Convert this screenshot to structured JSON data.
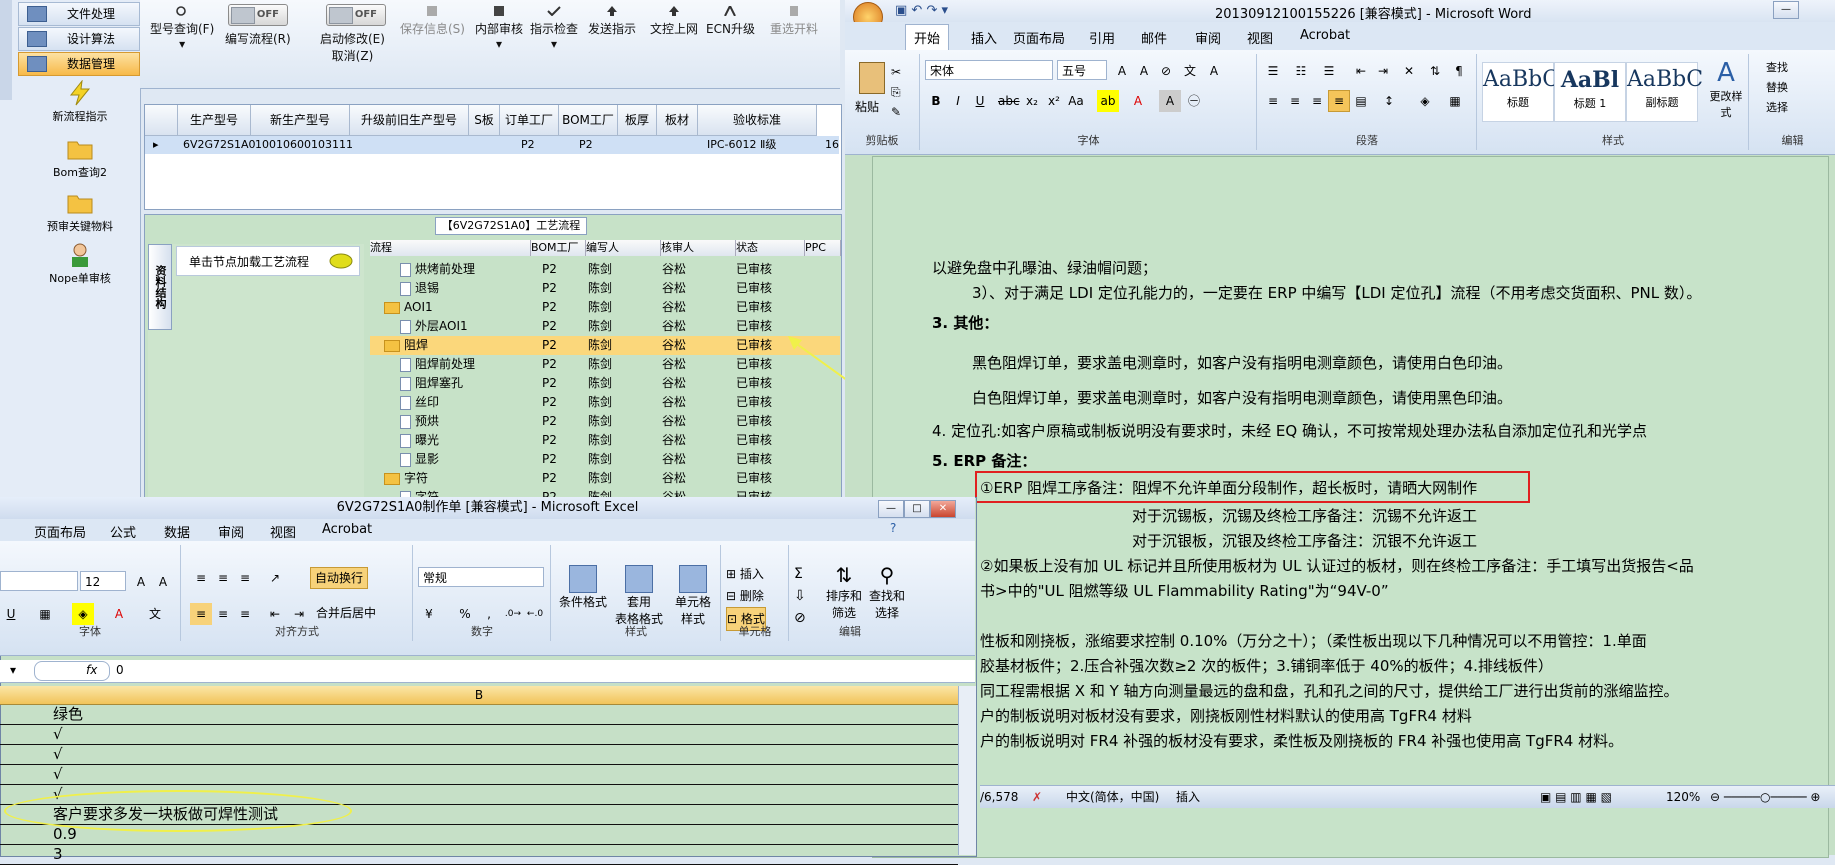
{
  "left_app": {
    "nav": [
      "文件处理",
      "设计算法",
      "数据管理"
    ],
    "tools": [
      "新流程指示",
      "Bom查询2",
      "预审关键物料",
      "Nope单审核"
    ],
    "toolbar": {
      "model_query": "型号查询(F)",
      "edit_flow": "编写流程(R)",
      "start_modify": "启动修改(E)",
      "cancel": "取消(Z)",
      "save_info": "保存信息(S)",
      "internal_review": "内部审核",
      "instruction_check": "指示检查",
      "send_instruction": "发送指示",
      "text_upload": "文控上网",
      "ecn_upgrade": "ECN升级",
      "rename": "重选开料",
      "toggle_off": "OFF"
    },
    "grid": {
      "headers": [
        "生产型号",
        "新生产型号",
        "升级前旧生产型号",
        "S板",
        "订单工厂",
        "BOM工厂",
        "板厚",
        "板材",
        "验收标准"
      ],
      "row": [
        "6V2G72S1A0",
        "10010600103111",
        "",
        "",
        "P2",
        "P2",
        "",
        "",
        "IPC-6012 Ⅱ级",
        "16"
      ]
    },
    "process_title": "【6V2G72S1A0】工艺流程",
    "vertical_tab": "资料结构",
    "side_hint": "单击节点加载工艺流程",
    "tree_headers": [
      "流程",
      "BOM工厂",
      "编写人",
      "核审人",
      "状态",
      "PPC"
    ],
    "tree_rows": [
      {
        "name": "烘烤前处理",
        "kind": "doc",
        "indent": 1,
        "f": "P2",
        "w": "陈剑",
        "c": "谷松",
        "s": "已审核"
      },
      {
        "name": "退锡",
        "kind": "doc",
        "indent": 1,
        "f": "P2",
        "w": "陈剑",
        "c": "谷松",
        "s": "已审核"
      },
      {
        "name": "AOI1",
        "kind": "folder",
        "indent": 0,
        "f": "P2",
        "w": "陈剑",
        "c": "谷松",
        "s": "已审核"
      },
      {
        "name": "外层AOI1",
        "kind": "doc",
        "indent": 1,
        "f": "P2",
        "w": "陈剑",
        "c": "谷松",
        "s": "已审核"
      },
      {
        "name": "阻焊",
        "kind": "folder",
        "indent": 0,
        "f": "P2",
        "w": "陈剑",
        "c": "谷松",
        "s": "已审核",
        "selected": true
      },
      {
        "name": "阻焊前处理",
        "kind": "doc",
        "indent": 1,
        "f": "P2",
        "w": "陈剑",
        "c": "谷松",
        "s": "已审核"
      },
      {
        "name": "阻焊塞孔",
        "kind": "doc",
        "indent": 1,
        "f": "P2",
        "w": "陈剑",
        "c": "谷松",
        "s": "已审核"
      },
      {
        "name": "丝印",
        "kind": "doc",
        "indent": 1,
        "f": "P2",
        "w": "陈剑",
        "c": "谷松",
        "s": "已审核"
      },
      {
        "name": "预烘",
        "kind": "doc",
        "indent": 1,
        "f": "P2",
        "w": "陈剑",
        "c": "谷松",
        "s": "已审核"
      },
      {
        "name": "曝光",
        "kind": "doc",
        "indent": 1,
        "f": "P2",
        "w": "陈剑",
        "c": "谷松",
        "s": "已审核"
      },
      {
        "name": "显影",
        "kind": "doc",
        "indent": 1,
        "f": "P2",
        "w": "陈剑",
        "c": "谷松",
        "s": "已审核"
      },
      {
        "name": "字符",
        "kind": "folder",
        "indent": 0,
        "f": "P2",
        "w": "陈剑",
        "c": "谷松",
        "s": "已审核"
      },
      {
        "name": "字符",
        "kind": "doc",
        "indent": 1,
        "f": "P2",
        "w": "陈剑",
        "c": "谷松",
        "s": "已审核"
      }
    ]
  },
  "word": {
    "title": "20130912100155226 [兼容模式] - Microsoft Word",
    "tabs": [
      "开始",
      "插入",
      "页面布局",
      "引用",
      "邮件",
      "审阅",
      "视图",
      "Acrobat"
    ],
    "font_name": "宋体",
    "font_size": "五号",
    "groups": {
      "clipboard": "剪贴板",
      "font": "字体",
      "paragraph": "段落",
      "styles": "样式",
      "editing": "编辑"
    },
    "paste": "粘贴",
    "change_styles": "更改样式",
    "styles": [
      {
        "preview": "AaBbC",
        "name": "标题"
      },
      {
        "preview": "AaBl",
        "name": "标题 1"
      },
      {
        "preview": "AaBbC",
        "name": "副标题"
      }
    ],
    "right_items": [
      "查找",
      "替换",
      "选择"
    ],
    "lines": [
      "以避免盘中孔曝油、绿油帽问题；",
      "3）、对于满足 LDI 定位孔能力的，一定要在 ERP 中编写【LDI 定位孔】流程（不用考虑交货面积、PNL 数）。",
      "3. 其他：",
      "黑色阻焊订单，要求盖电测章时，如客户没有指明电测章颜色，请使用白色印油。",
      "白色阻焊订单，要求盖电测章时，如客户没有指明电测章颜色，请使用黑色印油。",
      "4. 定位孔:如客户原稿或制板说明没有要求时，未经 EQ 确认，不可按常规处理办法私自添加定位孔和光学点",
      "5. ERP 备注：",
      "①ERP 阻焊工序备注：阻焊不允许单面分段制作，超长板时，请晒大网制作",
      "对于沉锡板，沉锡及终检工序备注：沉锡不允许返工",
      "对于沉银板，沉银及终检工序备注：沉银不允许返工",
      "②如果板上没有加 UL 标记并且所使用板材为 UL 认证过的板材，则在终检工序备注：手工填写出货报告<品",
      "书>中的\"UL 阻燃等级 UL Flammability Rating\"为“94V-0”",
      "性板和刚挠板，涨缩要求控制 0.10%（万分之十）；（柔性板出现以下几种情况可以不用管控：1.单面",
      "胶基材板件；2.压合补强次数≥2 次的板件；3.铺铜率低于 40%的板件；4.排线板件）",
      "同工程需根据 X 和 Y 轴方向测量最远的盘和盘，孔和孔之间的尺寸，提供给工厂进行出货前的涨缩监控。",
      "户的制板说明对板材没有要求，刚挠板刚性材料默认的使用高 TgFR4 材料",
      "户的制板说明对 FR4 补强的板材没有要求，柔性板及刚挠板的 FR4 补强也使用高 TgFR4 材料。"
    ],
    "status": {
      "words": "/6,578",
      "lang": "中文(简体，中国)",
      "mode": "插入",
      "zoom": "120%"
    }
  },
  "excel": {
    "title": "6V2G72S1A0制作单 [兼容模式] - Microsoft Excel",
    "tabs": [
      "页面布局",
      "公式",
      "数据",
      "审阅",
      "视图",
      "Acrobat"
    ],
    "font_size": "12",
    "wrap": "自动换行",
    "merge": "合并后居中",
    "number_format": "常规",
    "percent": "%",
    "comma": ",",
    "groups": {
      "font": "字体",
      "align": "对齐方式",
      "number": "数字",
      "styles": "样式",
      "cells": "单元格",
      "editing": "编辑"
    },
    "style_btns": [
      "条件格式",
      "套用\n表格格式",
      "单元格\n样式"
    ],
    "cell_btns": [
      "插入",
      "删除",
      "格式"
    ],
    "edit_btns": [
      "排序和\n筛选",
      "查找和\n选择"
    ],
    "formula_value": "0",
    "column_b": "B",
    "rows": [
      "绿色",
      "√",
      "√",
      "√",
      "√",
      "客户要求多发一块板做可焊性测试",
      "0.9",
      "3"
    ]
  },
  "colors": {
    "red_box": "#e02020",
    "yellow_annot": "#f0f04a",
    "selected_row": "#fbd77b"
  }
}
